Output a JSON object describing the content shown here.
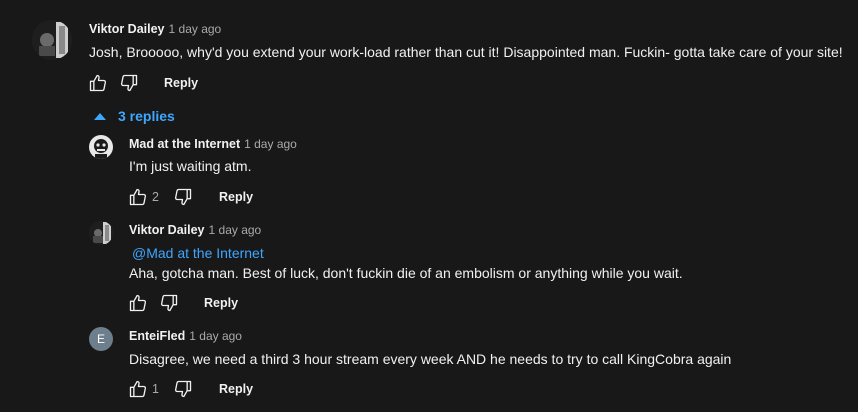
{
  "top": {
    "author": "Viktor Dailey",
    "time": "1 day ago",
    "text": "Josh, Brooooo, why'd you extend your work-load rather than cut it! Disappointed man. Fuckin- gotta take care of your site!",
    "reply_label": "Reply",
    "replies_toggle": "3 replies"
  },
  "replies": [
    {
      "author": "Mad at the Internet",
      "time": "1 day ago",
      "text": "I'm just waiting atm.",
      "likes": "2",
      "reply_label": "Reply"
    },
    {
      "author": "Viktor Dailey",
      "time": "1 day ago",
      "mention": "@Mad at the Internet",
      "text": "Aha, gotcha man. Best of luck, don't fuckin die of an embolism or anything while you wait.",
      "reply_label": "Reply"
    },
    {
      "author": "EnteiFled",
      "time": "1 day ago",
      "avatar_letter": "E",
      "text": "Disagree, we need a third 3 hour stream every week AND he needs to try to call KingCobra again",
      "likes": "1",
      "reply_label": "Reply"
    }
  ],
  "icons": {
    "like": "thumbs-up-icon",
    "dislike": "thumbs-down-icon",
    "toggle": "caret-up-icon"
  },
  "colors": {
    "background": "#181818",
    "text": "#f1f1f1",
    "muted": "#aaaaaa",
    "link": "#3ea6ff",
    "avatar_letter_bg": "#6d7f8c"
  }
}
